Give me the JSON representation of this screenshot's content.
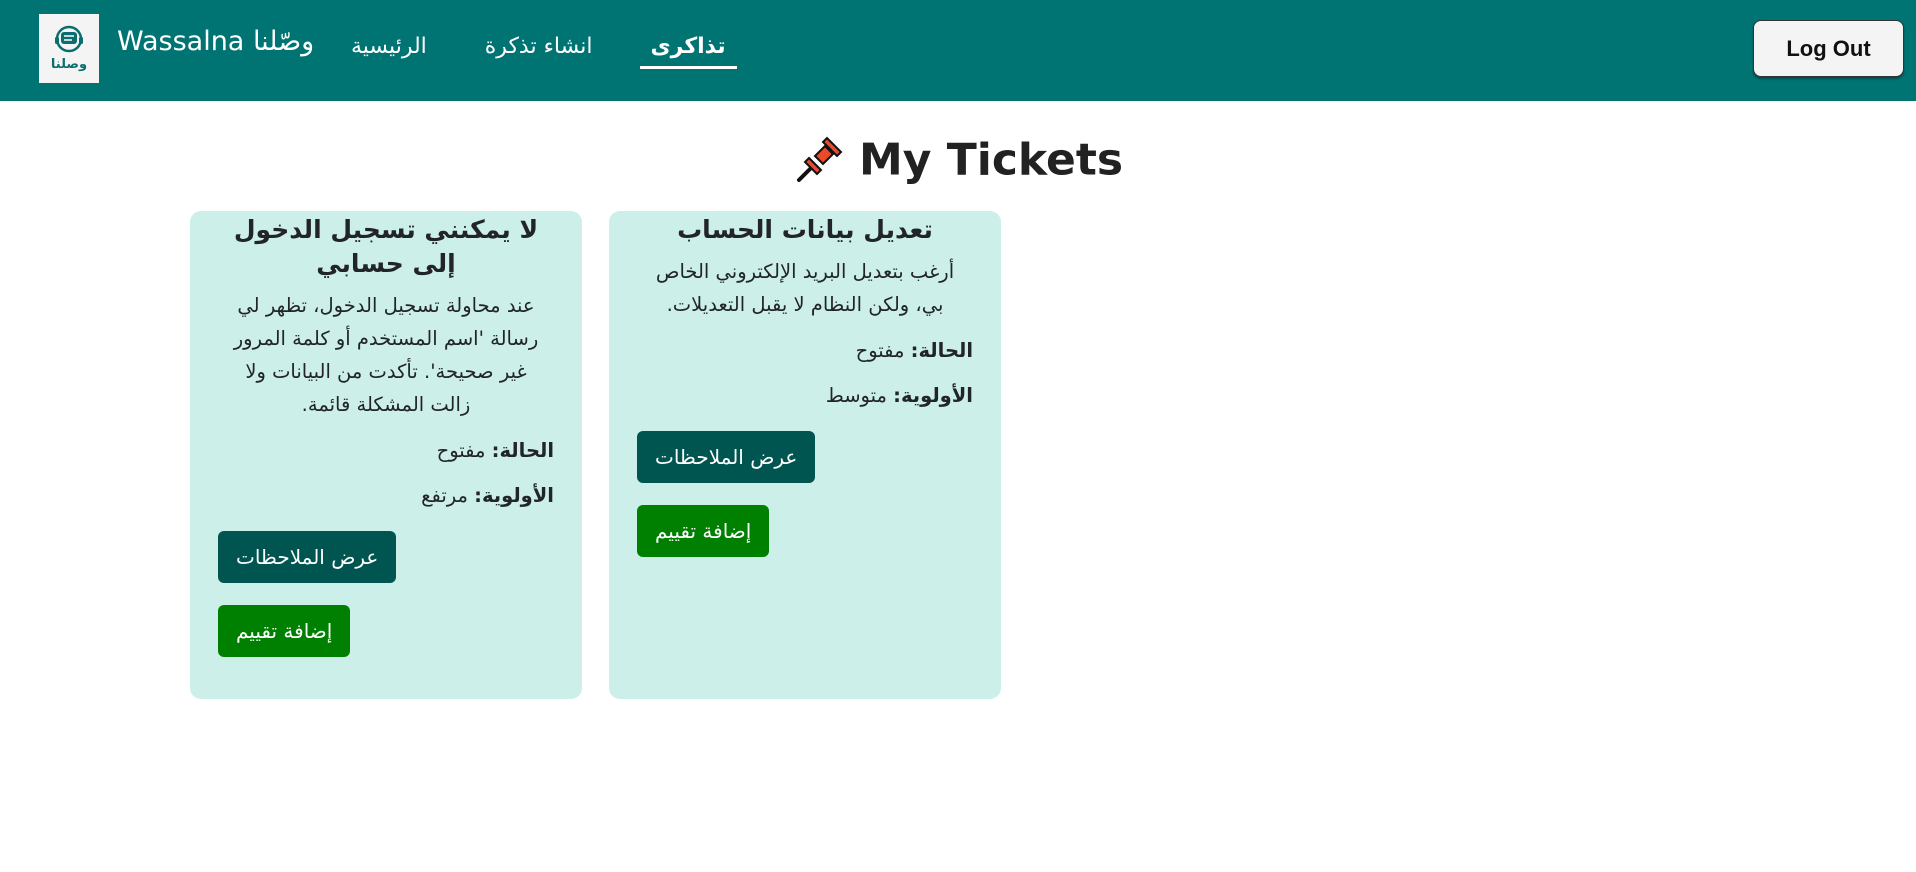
{
  "navbar": {
    "logo_text": "وصلنا",
    "brand_title": "Wassalna وصّلنا",
    "links": [
      {
        "label": "الرئيسية"
      },
      {
        "label": "انشاء تذكرة"
      },
      {
        "label": "تذاكرى"
      }
    ],
    "logout_label": "Log Out",
    "background_color": "#007373"
  },
  "page": {
    "heading": "My Tickets",
    "heading_icon": "pushpin-icon"
  },
  "tickets": [
    {
      "title": "لا يمكنني تسجيل الدخول إلى حسابي",
      "description": "عند محاولة تسجيل الدخول، تظهر لي رسالة 'اسم المستخدم أو كلمة المرور غير صحيحة'. تأكدت من البيانات ولا زالت المشكلة قائمة.",
      "status_label": "الحالة:",
      "status_value": "مفتوح",
      "priority_label": "الأولوية:",
      "priority_value": "مرتفع",
      "notes_button": "عرض الملاحظات",
      "rating_button": "إضافة تقييم"
    },
    {
      "title": "تعديل بيانات الحساب",
      "description": "أرغب بتعديل البريد الإلكتروني الخاص بي، ولكن النظام لا يقبل التعديلات.",
      "status_label": "الحالة:",
      "status_value": "مفتوح",
      "priority_label": "الأولوية:",
      "priority_value": "متوسط",
      "notes_button": "عرض الملاحظات",
      "rating_button": "إضافة تقييم"
    }
  ]
}
